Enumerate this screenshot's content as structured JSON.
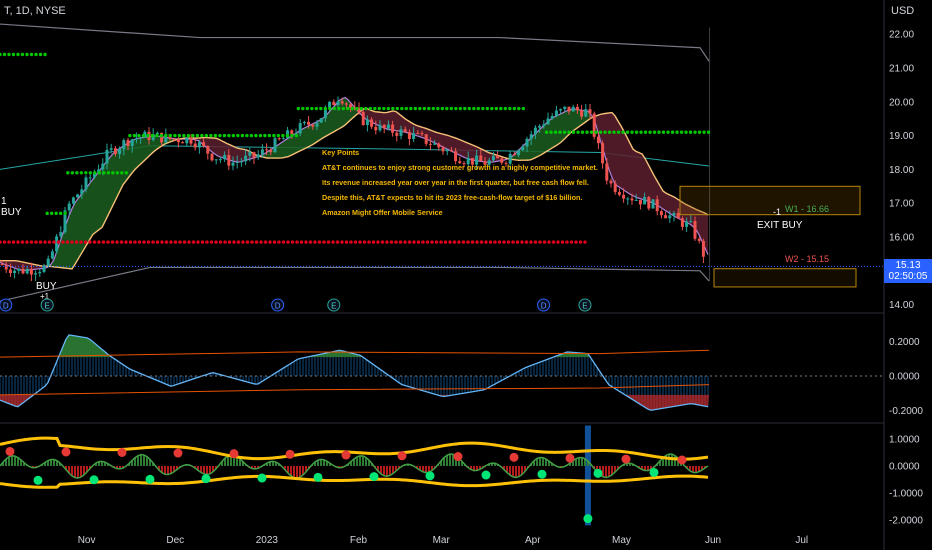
{
  "header": {
    "symbol": "T, 1D, NYSE",
    "currency": "USD"
  },
  "price_tag": {
    "price": "15.13",
    "countdown": "02:50:05"
  },
  "notes": {
    "title": "Key Points",
    "items": [
      "AT&T continues to enjoy strong customer growth in a highly competitive market.",
      "Its revenue increased year over year in the first quarter, but free cash flow fell.",
      "Despite this, AT&T expects to hit its 2023 free-cash-flow target of $16 billion.",
      "Amazon Might Offer Mobile Service"
    ]
  },
  "labels": {
    "buy_top": "1\nBUY",
    "buy_bottom": "BUY",
    "buy_bottom_sub": "+1",
    "exit_buy": "EXIT BUY",
    "exit_buy_sub": "-1",
    "w1": "W1 -  16.66",
    "w2": "W2 -  15.15"
  },
  "colors": {
    "background": "#000000",
    "up": "#26a69a",
    "down": "#ef5350",
    "cloud_green": "#1b5e20",
    "cloud_red": "#5d1f2e",
    "green_dots": "#00c800",
    "red_dots": "#e0001a",
    "band": "#787b86",
    "fast_line": "#f6c177",
    "slow_line": "#b07fd8",
    "teal_line": "#26a6a6",
    "oscillator_yellow": "#ffc107",
    "accent_blue": "#2962ff"
  },
  "chart_data": [
    {
      "type": "line",
      "panel": "price",
      "title": "T, 1D, NYSE",
      "x_ticks": [
        "Nov",
        "Dec",
        "2023",
        "Feb",
        "Mar",
        "Apr",
        "May",
        "Jun",
        "Jul"
      ],
      "y_ticks": [
        "22.00",
        "21.00",
        "20.00",
        "19.00",
        "18.00",
        "17.00",
        "16.00",
        "15.00",
        "14.00"
      ],
      "ylim": [
        13.8,
        22.6
      ],
      "event_markers": [
        {
          "label": "D",
          "x": "Oct 06"
        },
        {
          "label": "E",
          "x": "Oct 20"
        },
        {
          "label": "D",
          "x": "Jan 06"
        },
        {
          "label": "E",
          "x": "Jan 25"
        },
        {
          "label": "D",
          "x": "Apr 06"
        },
        {
          "label": "E",
          "x": "Apr 20"
        }
      ],
      "series": [
        {
          "name": "close",
          "x": [
            "Oct 01",
            "Oct 10",
            "Oct 20",
            "Oct 27",
            "Nov 03",
            "Nov 10",
            "Nov 17",
            "Nov 24",
            "Dec 01",
            "Dec 08",
            "Dec 15",
            "Dec 22",
            "Dec 30",
            "Jan 06",
            "Jan 13",
            "Jan 20",
            "Jan 27",
            "Feb 03",
            "Feb 10",
            "Feb 17",
            "Feb 24",
            "Mar 03",
            "Mar 10",
            "Mar 17",
            "Mar 24",
            "Mar 31",
            "Apr 07",
            "Apr 14",
            "Apr 21",
            "Apr 28",
            "May 05",
            "May 12",
            "May 19",
            "May 26",
            "Jun 01"
          ],
          "values": [
            15.3,
            15.0,
            15.1,
            16.9,
            17.7,
            18.5,
            18.9,
            19.0,
            18.9,
            18.9,
            18.4,
            18.2,
            18.4,
            18.8,
            19.2,
            19.5,
            20.2,
            19.5,
            19.2,
            19.1,
            18.9,
            18.6,
            18.3,
            18.2,
            18.3,
            18.9,
            19.5,
            19.8,
            19.7,
            17.6,
            17.2,
            17.0,
            16.6,
            16.3,
            15.13
          ]
        },
        {
          "name": "green_stop",
          "segments": [
            {
              "x": [
                "Sep 25",
                "Oct 20"
              ],
              "value": 21.4
            },
            {
              "x": [
                "Oct 20",
                "Oct 27"
              ],
              "value": 16.7
            },
            {
              "x": [
                "Oct 27",
                "Nov 17"
              ],
              "value": 17.9
            },
            {
              "x": [
                "Nov 17",
                "Jan 13"
              ],
              "value": 19.0
            },
            {
              "x": [
                "Jan 13",
                "Mar 31"
              ],
              "value": 19.8
            },
            {
              "x": [
                "Apr 07",
                "Jun 01"
              ],
              "value": 19.1
            }
          ]
        },
        {
          "name": "red_stop",
          "segments": [
            {
              "x": [
                "Sep 25",
                "Apr 21"
              ],
              "value": 15.85
            }
          ]
        },
        {
          "name": "upper_band",
          "values_start_end": [
            22.3,
            21.2
          ]
        },
        {
          "name": "lower_band",
          "values_start_end": [
            14.1,
            14.7
          ]
        }
      ],
      "boxes": [
        {
          "label": "W1 -  16.66",
          "y": [
            16.66,
            17.5
          ]
        },
        {
          "label": "W2 -  15.15",
          "y": [
            14.7,
            15.15
          ]
        }
      ]
    },
    {
      "type": "area",
      "panel": "oscillator_1",
      "y_ticks": [
        "0.2000",
        "0.0000",
        "-0.2000"
      ],
      "ylim": [
        -0.3,
        0.3
      ],
      "series": [
        {
          "name": "blue",
          "x": [
            "Oct 01",
            "Oct 10",
            "Oct 20",
            "Oct 27",
            "Nov 03",
            "Nov 10",
            "Nov 17",
            "Dec 01",
            "Dec 15",
            "Dec 30",
            "Jan 13",
            "Jan 27",
            "Feb 03",
            "Feb 17",
            "Mar 03",
            "Mar 17",
            "Mar 31",
            "Apr 14",
            "Apr 21",
            "Apr 28",
            "May 12",
            "May 26",
            "Jun 01"
          ],
          "values": [
            -0.12,
            -0.18,
            -0.05,
            0.24,
            0.22,
            0.12,
            0.04,
            -0.06,
            0.02,
            -0.05,
            0.1,
            0.15,
            0.12,
            -0.05,
            -0.12,
            -0.08,
            0.05,
            0.14,
            0.13,
            -0.05,
            -0.2,
            -0.16,
            -0.18
          ]
        }
      ]
    },
    {
      "type": "line",
      "panel": "oscillator_2",
      "y_ticks": [
        "1.0000",
        "0.0000",
        "-1.0000",
        "-2.0000"
      ],
      "ylim": [
        -2.3,
        1.4
      ],
      "series": [
        {
          "name": "upper_envelope",
          "values_start_end": [
            0.55,
            0.6
          ]
        },
        {
          "name": "lower_envelope",
          "values_start_end": [
            -0.55,
            -0.55
          ]
        }
      ]
    }
  ]
}
